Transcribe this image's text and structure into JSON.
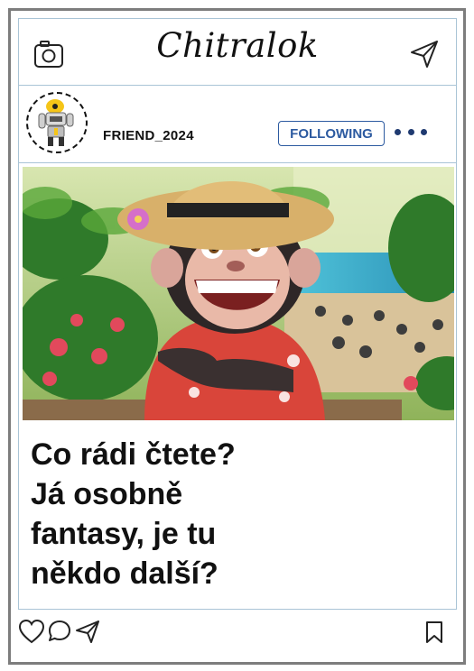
{
  "app": {
    "name": "Chitralok"
  },
  "profile": {
    "username": "FRIEND_2024",
    "follow_label": "FOLLOWING",
    "more_icon": "more-dots-icon"
  },
  "post": {
    "image_icon": "monkey-photo",
    "caption_lines": [
      "Co rádi čtete?",
      "Já osobně",
      "fantasy, je tu",
      "někdo další?"
    ]
  },
  "actions": {
    "icons": [
      "heart-icon",
      "comment-icon",
      "share-icon",
      "bookmark-icon"
    ]
  },
  "colors": {
    "frame": "#7d7d7d",
    "divider": "#a9c4d6",
    "accent": "#2c5aa0"
  }
}
